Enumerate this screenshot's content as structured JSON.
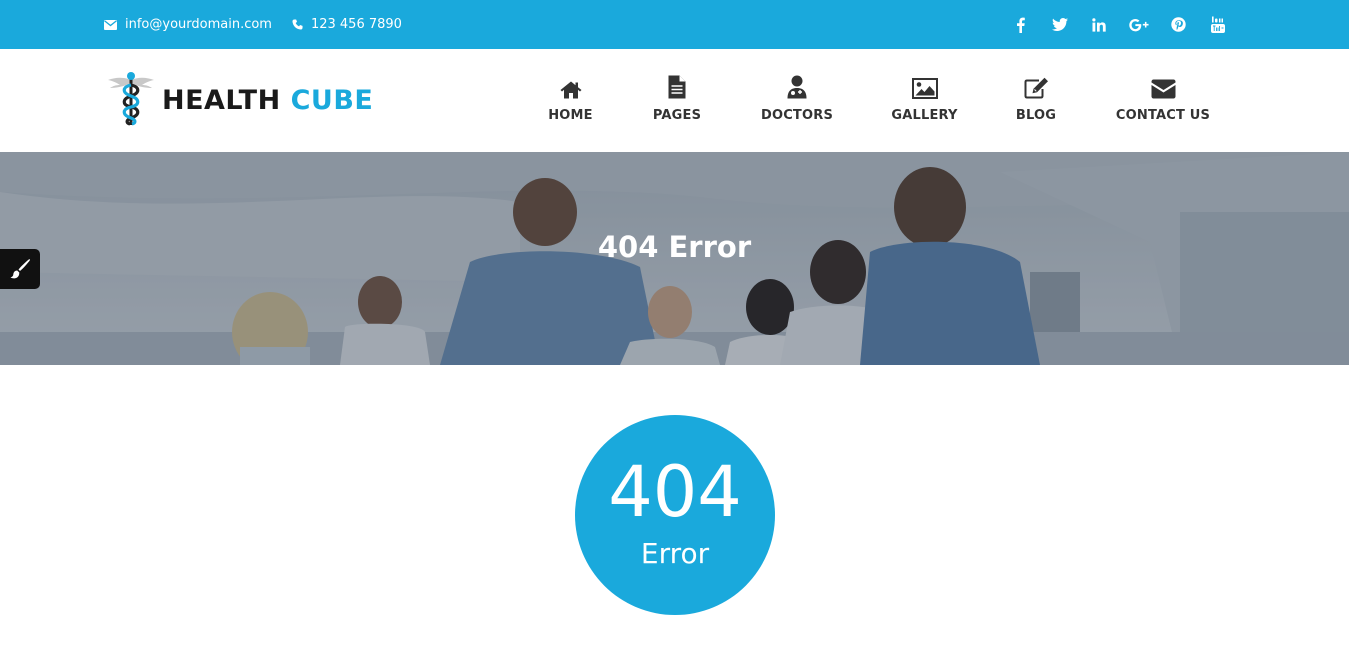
{
  "topbar": {
    "email": "info@yourdomain.com",
    "phone": "123 456 7890",
    "social_icons": [
      "facebook-icon",
      "twitter-icon",
      "linkedin-icon",
      "google-plus-icon",
      "pinterest-icon",
      "youtube-icon"
    ]
  },
  "brand": {
    "name_part1": "HEALTH",
    "name_part2": "CUBE"
  },
  "nav": {
    "items": [
      {
        "label": "HOME",
        "icon": "home-icon"
      },
      {
        "label": "PAGES",
        "icon": "document-icon"
      },
      {
        "label": "DOCTORS",
        "icon": "doctor-icon"
      },
      {
        "label": "GALLERY",
        "icon": "picture-icon"
      },
      {
        "label": "BLOG",
        "icon": "edit-icon"
      },
      {
        "label": "CONTACT US",
        "icon": "envelope-icon"
      }
    ]
  },
  "banner": {
    "title": "404 Error"
  },
  "error": {
    "code": "404",
    "label": "Error"
  },
  "colors": {
    "accent": "#1aa9dc",
    "text_dark": "#333333"
  }
}
